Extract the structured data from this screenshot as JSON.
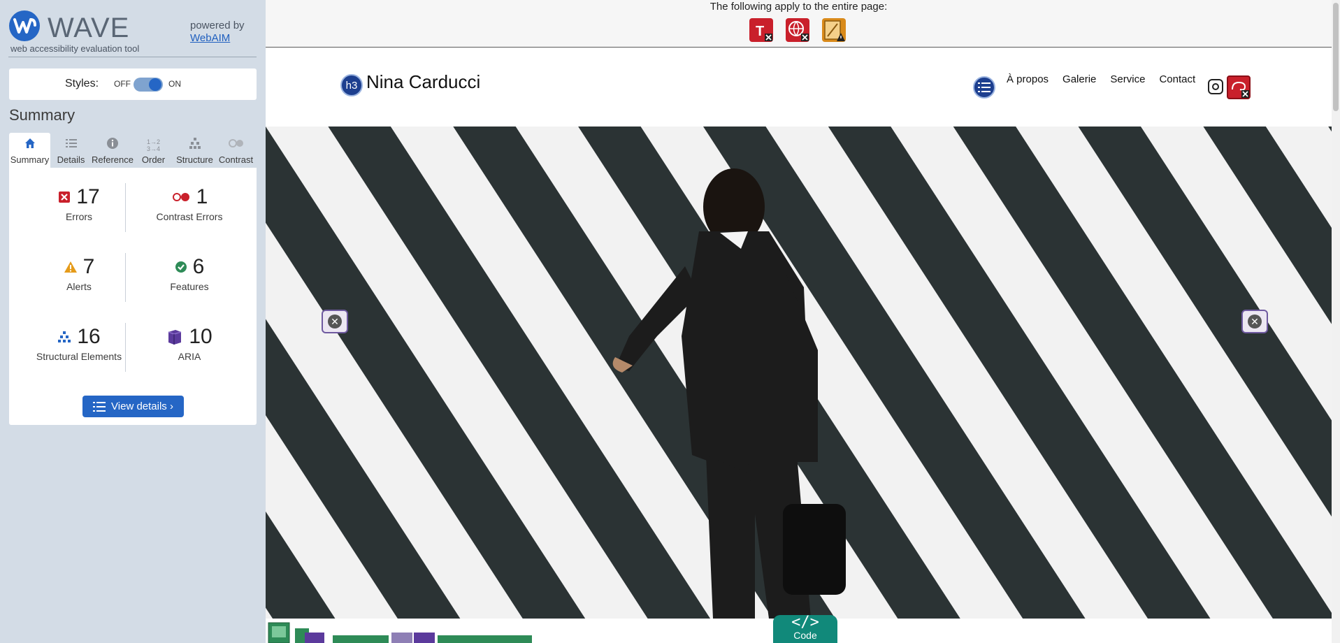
{
  "sidebar": {
    "brand_name": "WAVE",
    "brand_tagline": "web accessibility evaluation tool",
    "powered_by": "powered by",
    "webaim_link": "WebAIM",
    "styles_label": "Styles:",
    "styles_off": "OFF",
    "styles_on": "ON",
    "styles_enabled": true,
    "summary_heading": "Summary",
    "tabs": [
      {
        "label": "Summary",
        "icon": "home-icon",
        "active": true
      },
      {
        "label": "Details",
        "icon": "list-icon",
        "active": false
      },
      {
        "label": "Reference",
        "icon": "info-icon",
        "active": false
      },
      {
        "label": "Order",
        "icon": "order-icon",
        "active": false
      },
      {
        "label": "Structure",
        "icon": "structure-icon",
        "active": false
      },
      {
        "label": "Contrast",
        "icon": "contrast-icon",
        "active": false
      }
    ],
    "stats": {
      "errors": {
        "count": "17",
        "label": "Errors",
        "color": "#c9202b"
      },
      "contrast_errors": {
        "count": "1",
        "label": "Contrast Errors",
        "color": "#c9202b"
      },
      "alerts": {
        "count": "7",
        "label": "Alerts",
        "color": "#e59b1a"
      },
      "features": {
        "count": "6",
        "label": "Features",
        "color": "#2e8b57"
      },
      "structural": {
        "count": "16",
        "label": "Structural Elements",
        "color": "#2566c5"
      },
      "aria": {
        "count": "10",
        "label": "ARIA",
        "color": "#5b3a9c"
      }
    },
    "view_details": "View details ›"
  },
  "page_bar": {
    "text": "The following apply to the entire page:",
    "icons": [
      "language-missing-icon",
      "page-title-error-icon",
      "alert-icon"
    ]
  },
  "site": {
    "heading_badge": "h3",
    "title": "Nina Carducci",
    "nav": [
      "À propos",
      "Galerie",
      "Service",
      "Contact"
    ]
  },
  "code_tab": {
    "glyph": "</>",
    "label": "Code"
  },
  "colors": {
    "accent": "#2566c5",
    "sidebar_bg": "#d3dce6",
    "error": "#c9202b",
    "code_tab": "#11897a"
  }
}
